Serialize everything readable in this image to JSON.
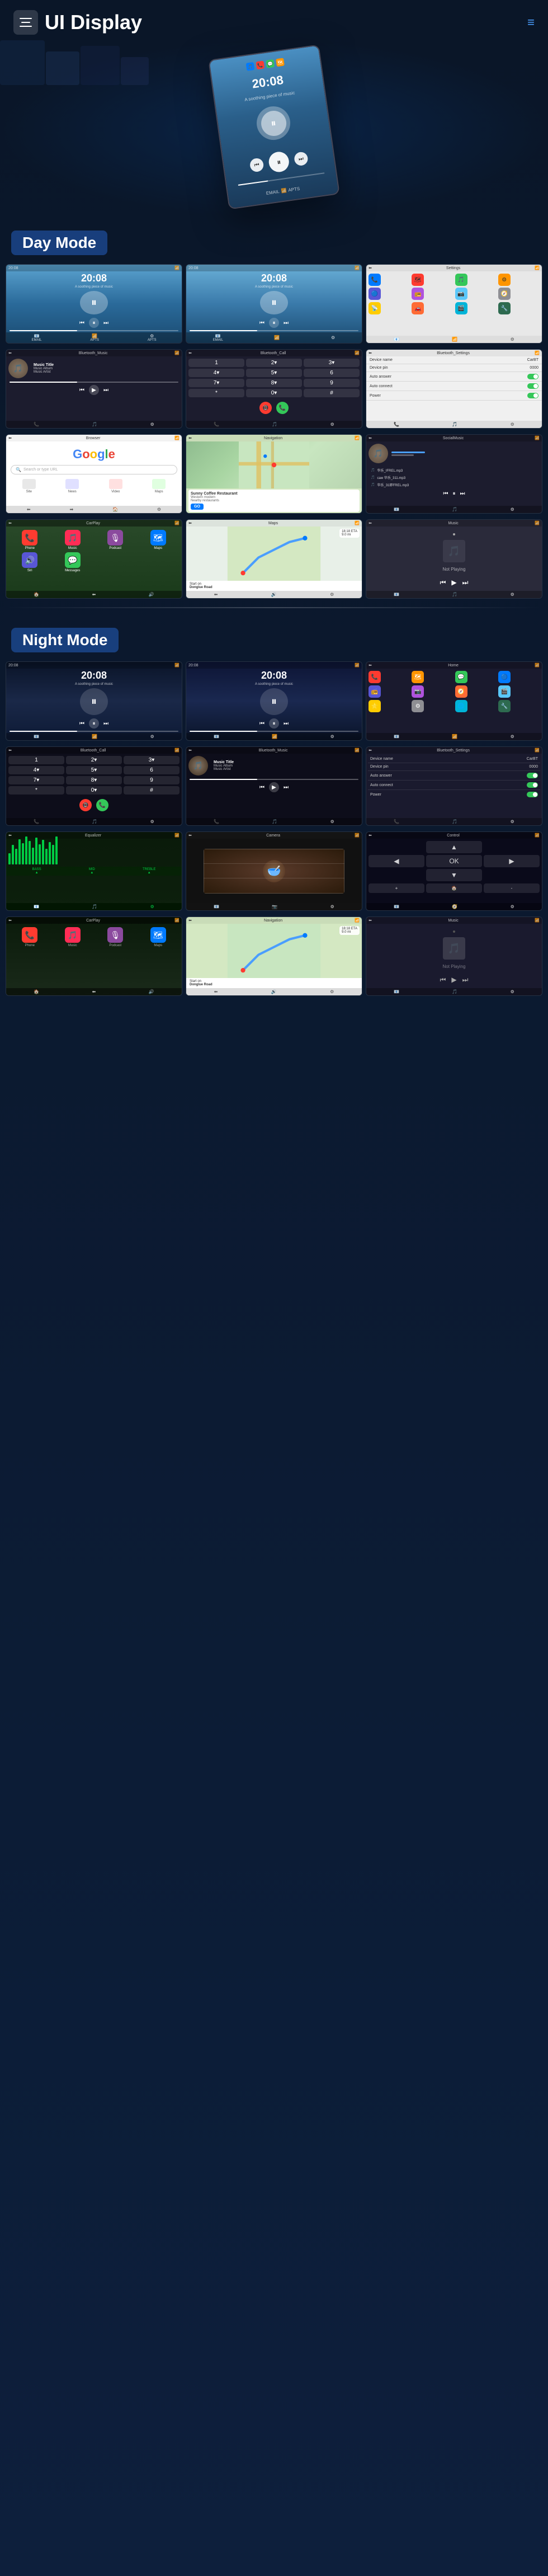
{
  "page": {
    "title": "UI Display",
    "menu_icon_label": "Menu",
    "nav_icon_label": "Navigation"
  },
  "day_mode": {
    "label": "Day Mode",
    "screens": [
      {
        "id": "day-music-1",
        "type": "music_day",
        "time": "20:08",
        "subtitle": "A soothing piece of music"
      },
      {
        "id": "day-music-2",
        "type": "music_day2",
        "time": "20:08",
        "subtitle": "A soothing piece of music"
      },
      {
        "id": "day-settings",
        "type": "settings_day"
      }
    ],
    "screens2": [
      {
        "id": "bt-music",
        "type": "bluetooth_music",
        "header": "Bluetooth_Music",
        "music_title": "Music Title",
        "music_album": "Music Album",
        "music_artist": "Music Artist"
      },
      {
        "id": "bt-call",
        "type": "bluetooth_call",
        "header": "Bluetooth_Call"
      },
      {
        "id": "bt-settings",
        "type": "bluetooth_settings",
        "header": "Bluetooth_Settings"
      }
    ],
    "screens3": [
      {
        "id": "google",
        "type": "google"
      },
      {
        "id": "maps",
        "type": "maps"
      },
      {
        "id": "local-music",
        "type": "local_music",
        "header": "SocialMusic"
      }
    ],
    "screens4": [
      {
        "id": "carplay",
        "type": "carplay"
      },
      {
        "id": "navigation",
        "type": "navigation"
      },
      {
        "id": "not-playing",
        "type": "not_playing"
      }
    ]
  },
  "night_mode": {
    "label": "Night Mode",
    "screens": [
      {
        "id": "night-music-1",
        "type": "music_night",
        "time": "20:08",
        "subtitle": "A soothing piece of music"
      },
      {
        "id": "night-music-2",
        "type": "music_night2",
        "time": "20:08",
        "subtitle": "A soothing piece of music"
      },
      {
        "id": "night-settings",
        "type": "settings_night"
      }
    ],
    "screens2": [
      {
        "id": "night-bt-call",
        "type": "bt_call_night",
        "header": "Bluetooth_Call"
      },
      {
        "id": "night-bt-music",
        "type": "bt_music_night",
        "header": "Bluetooth_Music",
        "music_title": "Music Title",
        "music_album": "Music Album",
        "music_artist": "Music Artist"
      },
      {
        "id": "night-bt-settings",
        "type": "settings_night_panel",
        "header": "Bluetooth_Settings"
      }
    ],
    "screens3": [
      {
        "id": "waveform",
        "type": "waveform"
      },
      {
        "id": "camera",
        "type": "camera"
      },
      {
        "id": "nav-control",
        "type": "navigation_control"
      }
    ],
    "screens4": [
      {
        "id": "carplay-night",
        "type": "carplay_night"
      },
      {
        "id": "maps-night",
        "type": "maps_night"
      },
      {
        "id": "not-playing-night",
        "type": "not_playing_night"
      }
    ]
  },
  "settings_items": [
    {
      "label": "Device name",
      "value": "CarBT"
    },
    {
      "label": "Device pin",
      "value": "0000"
    },
    {
      "label": "Auto answer",
      "value": "toggle"
    },
    {
      "label": "Auto connect",
      "value": "toggle"
    },
    {
      "label": "Power",
      "value": "toggle"
    }
  ],
  "numpad_keys": [
    "1",
    "2",
    "3",
    "4",
    "5",
    "6",
    "7",
    "8",
    "9",
    "*",
    "0",
    "#"
  ],
  "local_music_files": [
    "华乐_IFREL.mp3",
    "caw 华乐_311.mp3",
    "华乐_31即FREL.mp3"
  ],
  "place_card": {
    "name": "Sunny Coffee Restaurant",
    "address": "Western modern",
    "detail_label": "Nearby restaurants",
    "button": "GO"
  },
  "navigation_info": {
    "eta": "18:18 ETA",
    "distance": "9.0 mi",
    "start_on": "Start on",
    "road": "Donglue Road",
    "not_playing": "Not Playing"
  },
  "wave_heights": [
    20,
    35,
    28,
    45,
    38,
    50,
    42,
    30,
    48,
    36,
    44,
    28,
    40,
    35,
    50,
    30,
    42,
    38,
    25,
    45,
    32,
    48,
    36,
    40
  ],
  "app_icons": [
    {
      "color": "blue",
      "emoji": "📞"
    },
    {
      "color": "red",
      "emoji": "🗺"
    },
    {
      "color": "green",
      "emoji": "💬"
    },
    {
      "color": "orange",
      "emoji": "🎵"
    },
    {
      "color": "purple",
      "emoji": "📻"
    },
    {
      "color": "teal",
      "emoji": "📺"
    },
    {
      "color": "yellow",
      "emoji": "⚙"
    },
    {
      "color": "gray",
      "emoji": "📱"
    }
  ],
  "colors": {
    "accent_blue": "#1e5fa0",
    "day_mode_bg": "#1a3a6a",
    "night_mode_bg": "#0a1428",
    "label_bg": "rgba(30,80,160,0.7)",
    "green_wave": "#00cc44"
  }
}
